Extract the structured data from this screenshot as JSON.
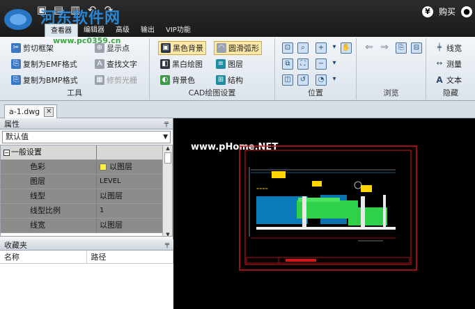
{
  "window": {
    "watermark": "河东软件网",
    "watermark_url": "www.pc0359.cn",
    "buy_label": "购买",
    "qat_icons": [
      "save-icon",
      "save-as-icon",
      "print-icon",
      "undo-icon",
      "redo-icon"
    ]
  },
  "tabs": [
    "查看器",
    "编辑器",
    "高级",
    "输出",
    "VIP功能"
  ],
  "ribbon": {
    "tools": {
      "label": "工具",
      "items": [
        "剪切框架",
        "复制为EMF格式",
        "复制为BMP格式",
        "显示点",
        "查找文字",
        "修剪光栅"
      ]
    },
    "cad_settings": {
      "label": "CAD绘图设置",
      "items": [
        "黑色背景",
        "黑白绘图",
        "背景色",
        "圆滑弧形",
        "图层",
        "结构"
      ]
    },
    "position": {
      "label": "位置"
    },
    "browse": {
      "label": "浏览"
    },
    "hide": {
      "label": "隐藏",
      "items": [
        "线宽",
        "测量",
        "文本"
      ]
    }
  },
  "document": {
    "tab": "a-1.dwg"
  },
  "properties": {
    "title": "属性",
    "dropdown": "默认值",
    "section": "一般设置",
    "rows": [
      {
        "key": "色彩",
        "value": "以图层"
      },
      {
        "key": "图层",
        "value": "LEVEL"
      },
      {
        "key": "线型",
        "value": "以图层"
      },
      {
        "key": "线型比例",
        "value": "1"
      },
      {
        "key": "线宽",
        "value": "以图层"
      }
    ]
  },
  "favorites": {
    "title": "收藏夹",
    "col_name": "名称",
    "col_path": "路径"
  },
  "canvas": {
    "site_watermark": "www.pHome.NET"
  }
}
